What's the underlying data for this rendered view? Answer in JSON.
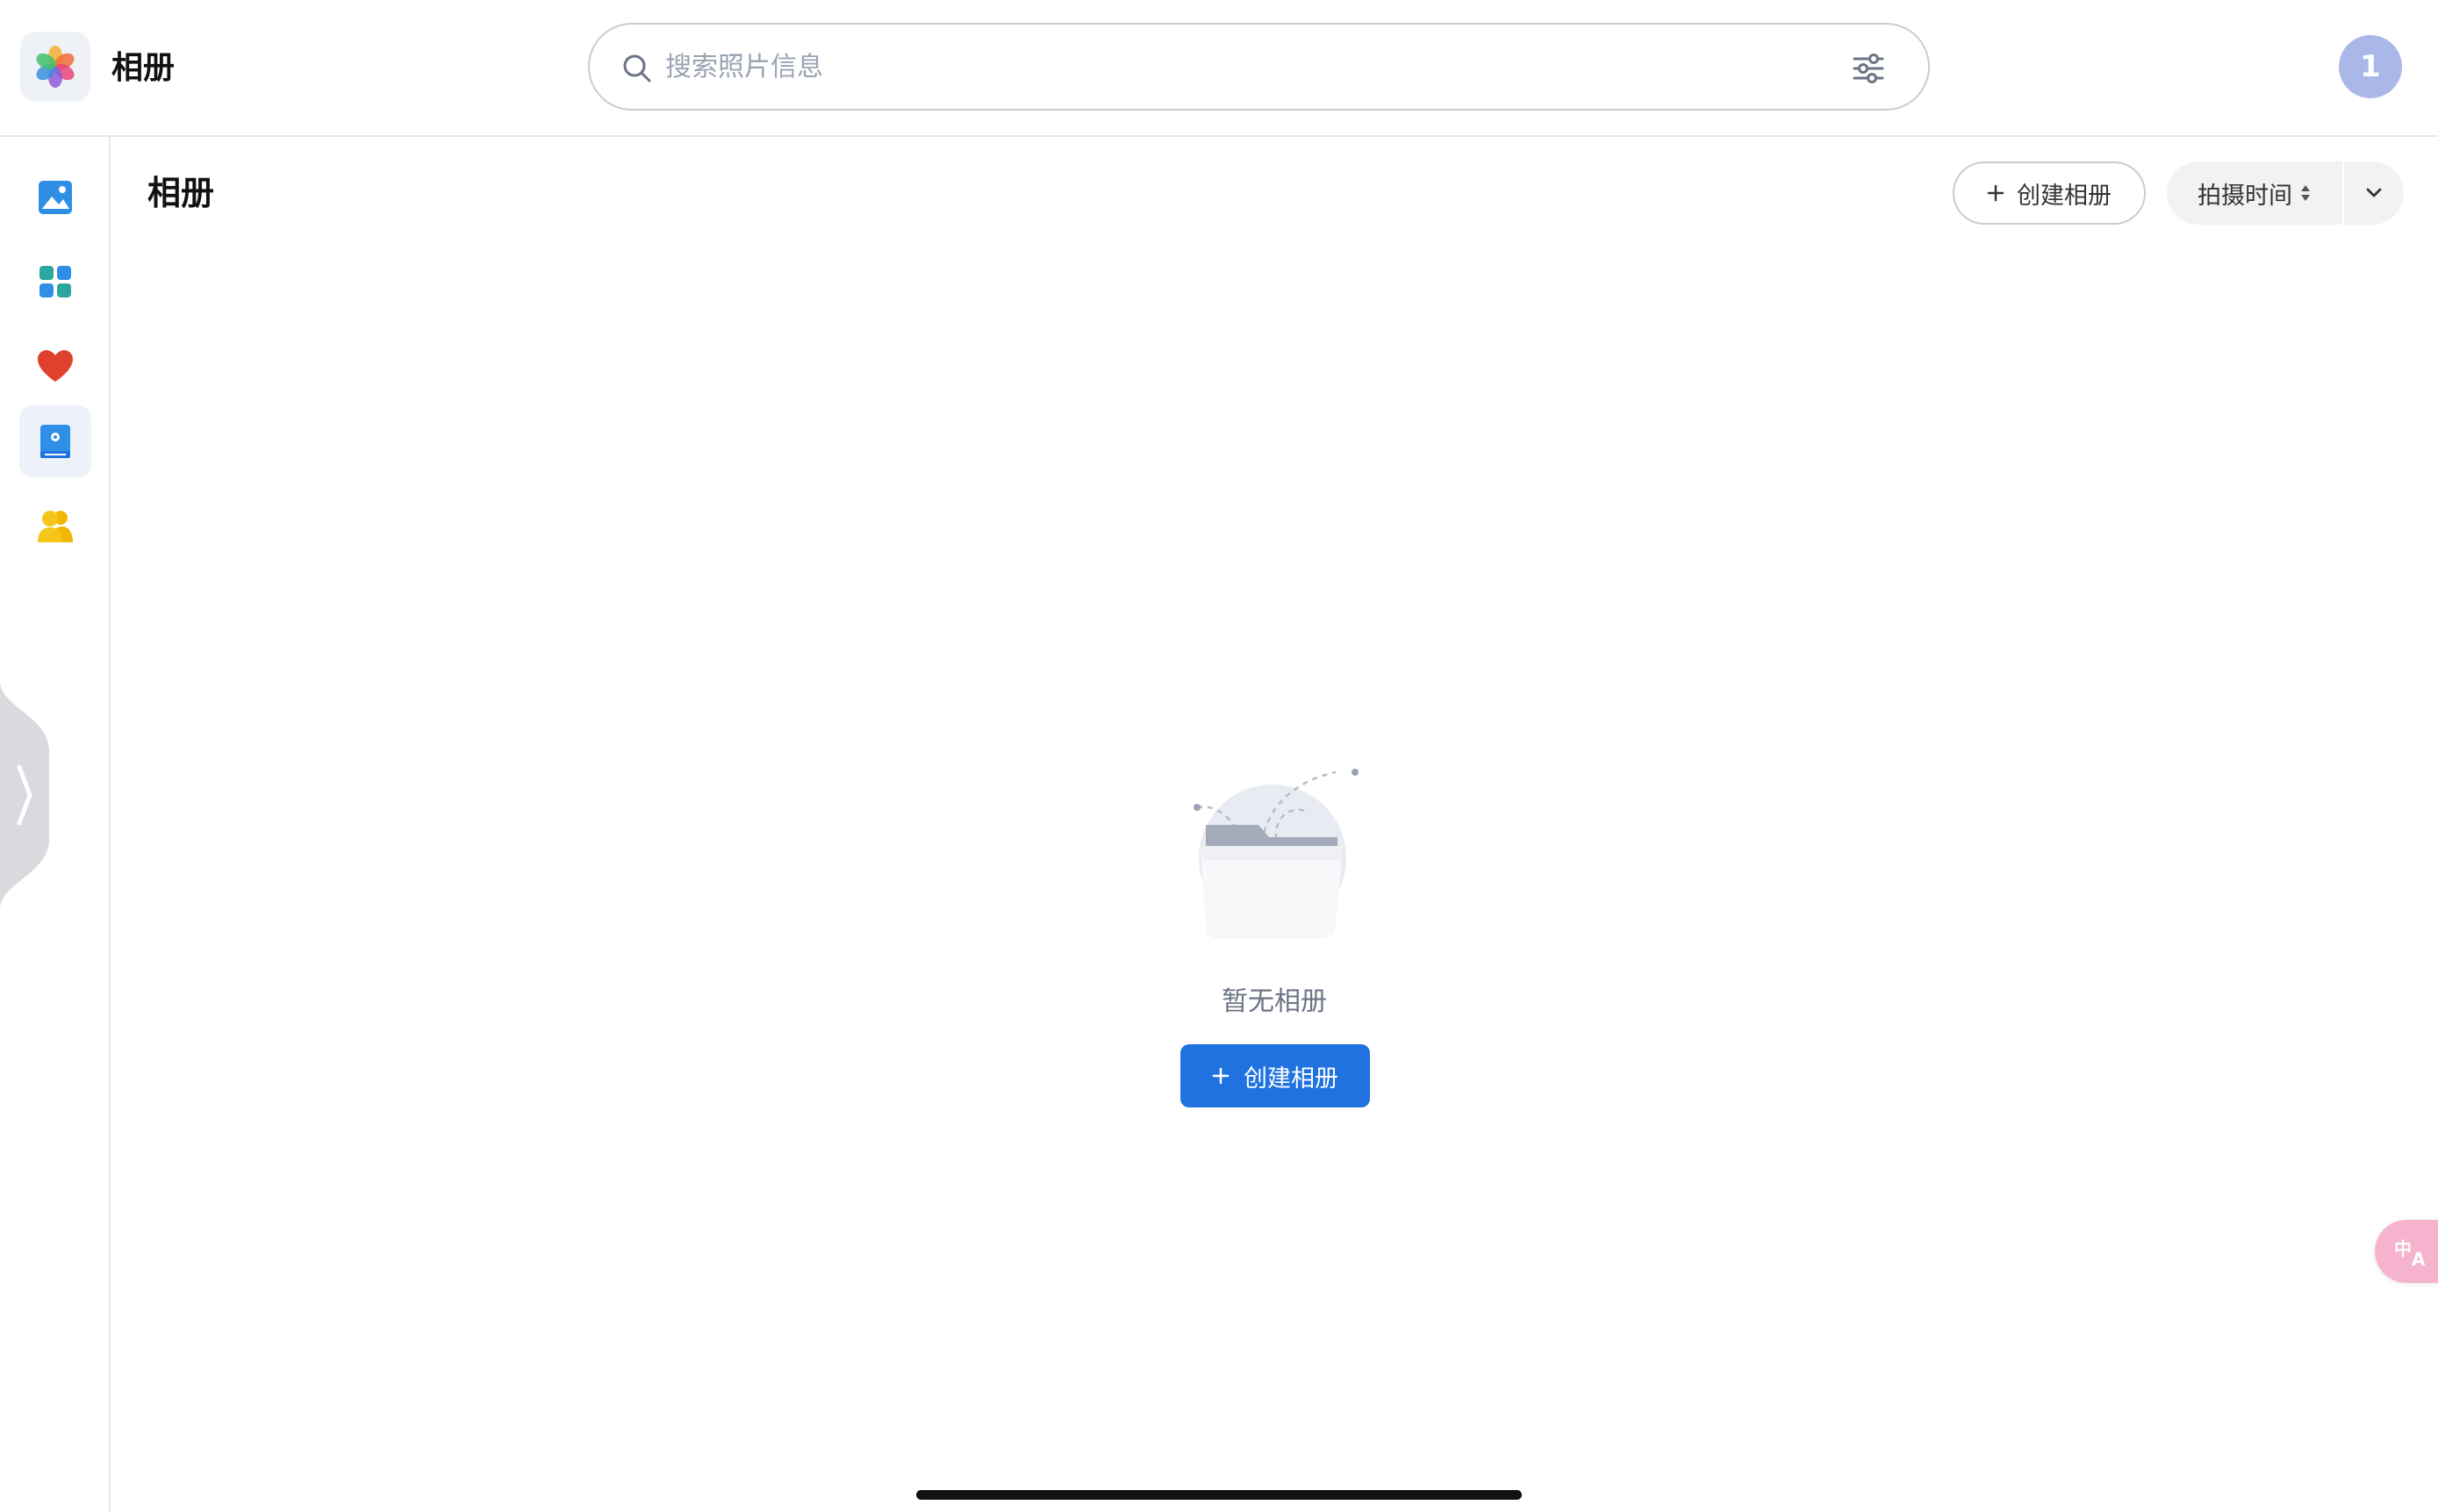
{
  "app": {
    "title": "相册",
    "logo_icon": "photos-flower-icon"
  },
  "search": {
    "placeholder": "搜索照片信息",
    "value": "",
    "search_icon": "search-icon",
    "filter_icon": "filter-sliders-icon"
  },
  "user": {
    "avatar_label": "1",
    "avatar_color": "#a9b8e8"
  },
  "sidebar": {
    "items": [
      {
        "name": "photos",
        "icon": "image-icon",
        "active": false
      },
      {
        "name": "explore",
        "icon": "grid-icon",
        "active": false
      },
      {
        "name": "favorites",
        "icon": "heart-icon",
        "active": false
      },
      {
        "name": "albums",
        "icon": "album-book-icon",
        "active": true
      },
      {
        "name": "people",
        "icon": "people-icon",
        "active": false
      }
    ],
    "expand_icon": "chevron-right-icon"
  },
  "main": {
    "title": "相册",
    "create_album_label": "创建相册",
    "sort_label": "拍摄时间",
    "sort_icon": "sort-updown-icon",
    "dropdown_icon": "chevron-down-icon"
  },
  "empty_state": {
    "illustration": "empty-folder-icon",
    "message": "暂无相册",
    "button_label": "创建相册"
  },
  "colors": {
    "accent": "#1f72e0",
    "translate_fab": "#f6b3cd"
  },
  "translate": {
    "icon": "translate-icon"
  }
}
